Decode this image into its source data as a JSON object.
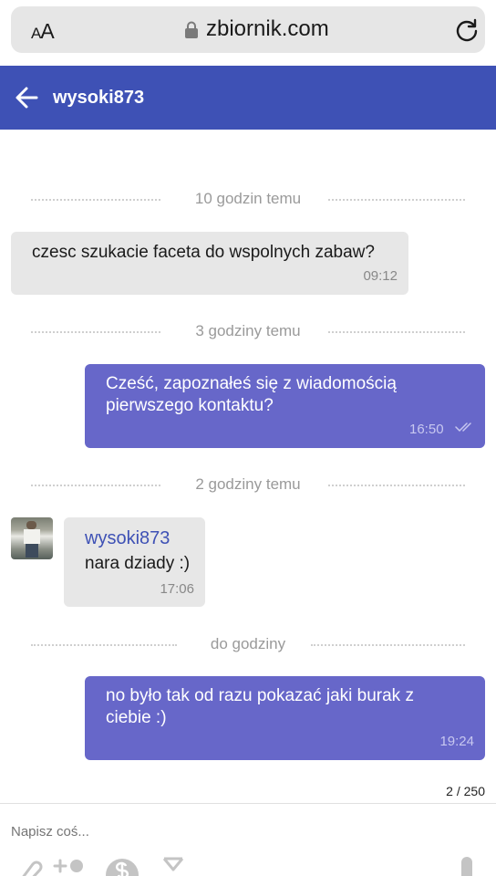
{
  "browser": {
    "aa_label_small": "A",
    "aa_label_big": "A",
    "url": "zbiornik.com"
  },
  "header": {
    "title": "wysoki873"
  },
  "separators": [
    "10 godzin temu",
    "3 godziny temu",
    "2 godziny temu",
    "do godziny"
  ],
  "messages": [
    {
      "direction": "incoming",
      "text": "czesc szukacie faceta do wspolnych zabaw?",
      "time": "09:12"
    },
    {
      "direction": "outgoing",
      "text": "Cześć, zapoznałeś się z wiadomością pierwszego kontaktu?",
      "time": "16:50",
      "read": true
    },
    {
      "direction": "incoming",
      "sender": "wysoki873",
      "text": "nara dziady :)",
      "time": "17:06"
    },
    {
      "direction": "outgoing",
      "text": "no było tak od razu pokazać jaki burak z ciebie :)",
      "time": "19:24"
    }
  ],
  "counter": "2 / 250",
  "composer": {
    "placeholder": "Napisz coś..."
  },
  "toolbar_icons": [
    "paperclip-icon",
    "add-person-icon",
    "dollar-icon",
    "hourglass-icon",
    "microphone-icon"
  ],
  "colors": {
    "header": "#3e51b5",
    "outgoing_bubble": "#6767c9",
    "incoming_bubble": "#e7e7e7"
  }
}
